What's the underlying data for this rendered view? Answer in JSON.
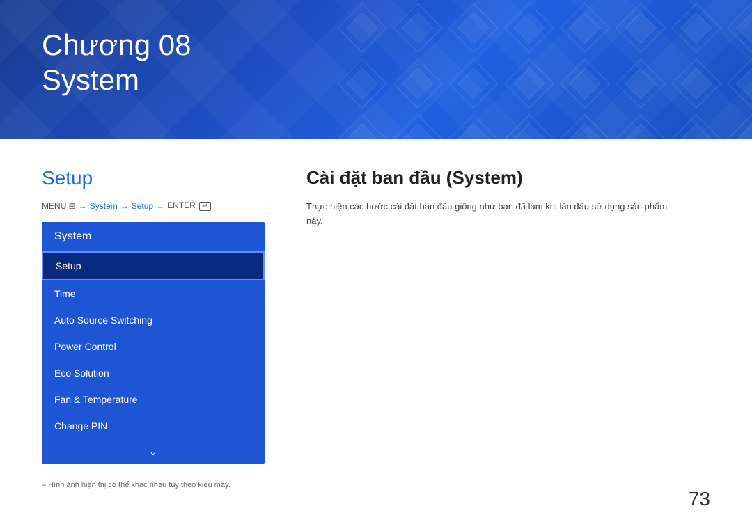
{
  "header": {
    "chapter": "Chương 08",
    "subtitle": "System"
  },
  "left": {
    "section_title": "Setup",
    "breadcrumb": {
      "menu": "MENU",
      "arrow1": "→",
      "system": "System",
      "arrow2": "→",
      "setup": "Setup",
      "arrow3": "→",
      "enter": "ENTER"
    },
    "menu": {
      "header": "System",
      "items": [
        {
          "label": "Setup",
          "selected": true
        },
        {
          "label": "Time",
          "selected": false
        },
        {
          "label": "Auto Source Switching",
          "selected": false
        },
        {
          "label": "Power Control",
          "selected": false
        },
        {
          "label": "Eco Solution",
          "selected": false
        },
        {
          "label": "Fan & Temperature",
          "selected": false
        },
        {
          "label": "Change PIN",
          "selected": false
        }
      ],
      "chevron": "⌄"
    }
  },
  "right": {
    "title": "Cài đặt ban đầu (System)",
    "description": "Thực hiện các bước cài đặt ban đầu giống như bạn đã làm khi lần đầu sử dụng sản phẩm này."
  },
  "footer": {
    "note": "– Hình ảnh hiện thị có thể khác nhau tùy theo kiểu máy."
  },
  "page_number": "73"
}
